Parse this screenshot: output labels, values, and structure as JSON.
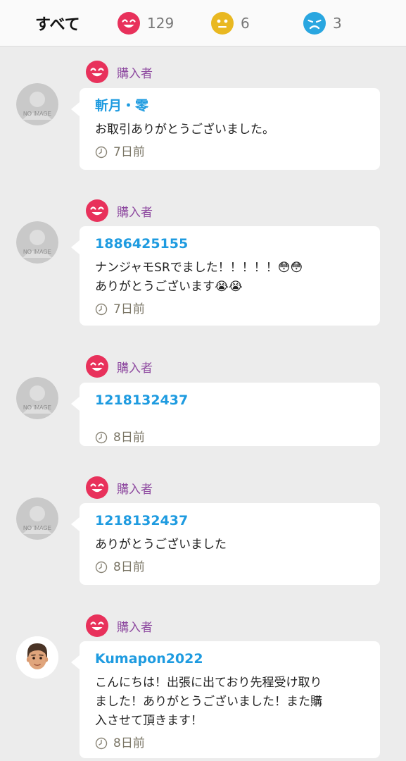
{
  "tabs": {
    "all_label": "すべて",
    "good_count": "129",
    "normal_count": "6",
    "bad_count": "3"
  },
  "colors": {
    "good": "#e8315b",
    "normal": "#e9b821",
    "bad": "#29a6e0",
    "username": "#1e9be0",
    "buyer_label": "#8e4aa0"
  },
  "reviews": [
    {
      "role": "購入者",
      "rating_icon": "smile-face-icon",
      "avatar": "no-image",
      "avatar_text": "NO IMAGE",
      "username": "斬月・零",
      "message": "お取引ありがとうございました。",
      "time": "7日前"
    },
    {
      "role": "購入者",
      "rating_icon": "smile-face-icon",
      "avatar": "no-image",
      "avatar_text": "NO IMAGE",
      "username": "1886425155",
      "message": "ナンジャモSRでました！！！！！😳😳\nありがとうございます😭😭",
      "time": "7日前"
    },
    {
      "role": "購入者",
      "rating_icon": "smile-face-icon",
      "avatar": "no-image",
      "avatar_text": "NO IMAGE",
      "username": "1218132437",
      "message": "",
      "time": "8日前"
    },
    {
      "role": "購入者",
      "rating_icon": "smile-face-icon",
      "avatar": "no-image",
      "avatar_text": "NO IMAGE",
      "username": "1218132437",
      "message": "ありがとうございました",
      "time": "8日前"
    },
    {
      "role": "購入者",
      "rating_icon": "smile-face-icon",
      "avatar": "memoji",
      "avatar_text": "",
      "username": "Kumapon2022",
      "message": "こんにちは！出張に出ており先程受け取り\nました！ありがとうございました！また購\n入させて頂きます！",
      "time": "8日前"
    }
  ]
}
